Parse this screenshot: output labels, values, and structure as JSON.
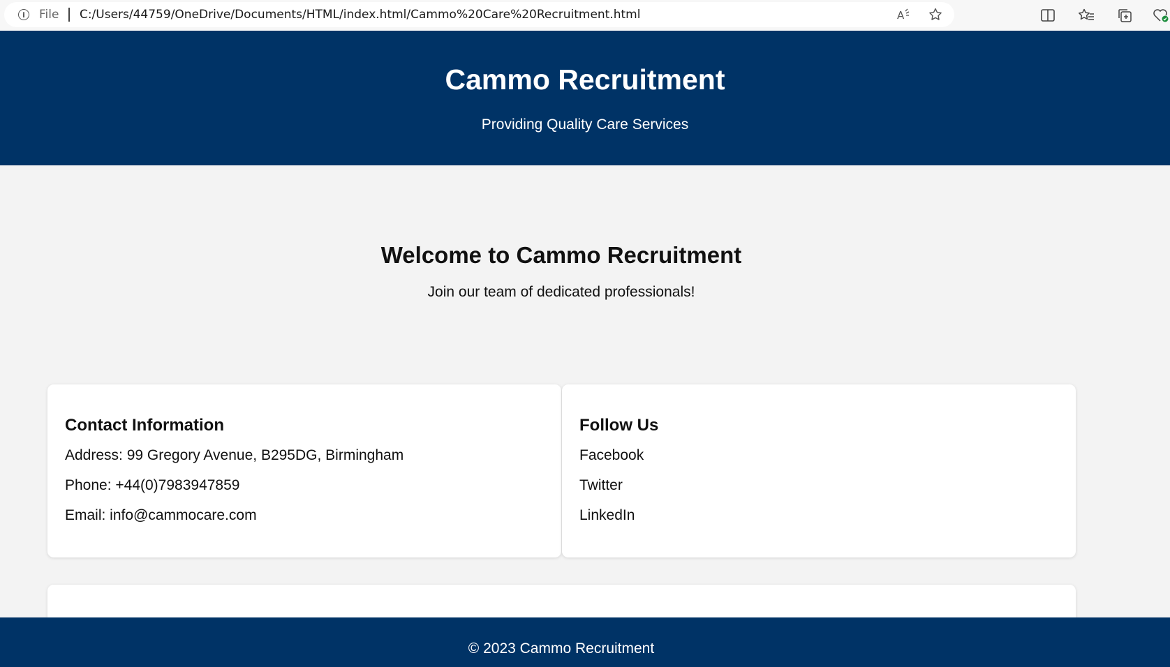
{
  "browser": {
    "file_label": "File",
    "url": "C:/Users/44759/OneDrive/Documents/HTML/index.html/Cammo%20Care%20Recruitment.html",
    "icons": [
      "info-icon",
      "read-aloud-icon",
      "favorite-star-icon",
      "split-screen-icon",
      "favorites-icon",
      "collections-icon",
      "browser-essentials-icon"
    ]
  },
  "header": {
    "title": "Cammo Recruitment",
    "tagline": "Providing Quality Care Services",
    "background": "#003366"
  },
  "hero": {
    "heading": "Welcome to Cammo Recruitment",
    "text": "Join our team of dedicated professionals!"
  },
  "contact": {
    "heading": "Contact Information",
    "address": "Address: 99 Gregory Avenue, B295DG, Birmingham",
    "phone": "Phone: +44(0)7983947859",
    "email": "Email: info@cammocare.com"
  },
  "social": {
    "heading": "Follow Us",
    "links": [
      "Facebook",
      "Twitter",
      "LinkedIn"
    ]
  },
  "footer": {
    "text": "© 2023 Cammo Recruitment"
  }
}
